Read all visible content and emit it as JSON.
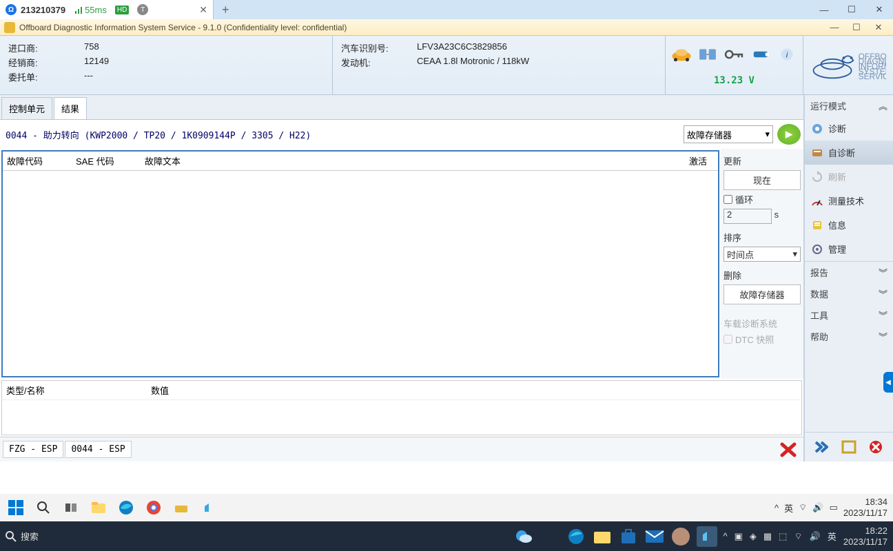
{
  "browserTab": {
    "title": "213210379",
    "ping": "55ms",
    "hd": "HD",
    "badge": "T"
  },
  "appTitle": "Offboard Diagnostic Information System Service - 9.1.0 (Confidentiality level: confidential)",
  "header": {
    "left": [
      {
        "label": "进口商:",
        "val": "758"
      },
      {
        "label": "经销商:",
        "val": "12149"
      },
      {
        "label": "委托单:",
        "val": "---"
      }
    ],
    "right": [
      {
        "label": "汽车识别号:",
        "val": "LFV3A23C6C3829856"
      },
      {
        "label": "发动机:",
        "val": "CEAA 1.8l Motronic / 118kW"
      }
    ],
    "voltage": "13.23 V"
  },
  "tabs": {
    "t1": "控制单元",
    "t2": "结果"
  },
  "module": "0044 - 助力转向  (KWP2000 / TP20 / 1K0909144P / 3305 / H22)",
  "comboMode": "故障存储器",
  "grid": {
    "h1": "故障代码",
    "h2": "SAE 代码",
    "h3": "故障文本",
    "h4": "激活"
  },
  "side": {
    "update": "更新",
    "now": "现在",
    "loop": "循环",
    "interval": "2",
    "intervalUnit": "s",
    "sort": "排序",
    "sortBy": "时间点",
    "delete": "删除",
    "delStore": "故障存储器",
    "obd": "车载诊断系统",
    "dtc": "DTC 快照"
  },
  "bottomGrid": {
    "c1": "类型/名称",
    "c2": "数值"
  },
  "status": {
    "s1": "FZG - ESP",
    "s2": "0044 - ESP"
  },
  "rside": {
    "mode": "运行模式",
    "items": {
      "diag": "诊断",
      "selfdiag": "自诊断",
      "refresh": "刷新",
      "measure": "测量技术",
      "info": "信息",
      "admin": "管理"
    },
    "sections": {
      "report": "报告",
      "data": "数据",
      "tools": "工具",
      "help": "帮助"
    }
  },
  "taskbar1": {
    "ime": "英",
    "time": "18:34",
    "date": "2023/11/17"
  },
  "taskbar2": {
    "search": "搜索",
    "ime": "英",
    "time": "18:22",
    "date": "2023/11/17"
  }
}
